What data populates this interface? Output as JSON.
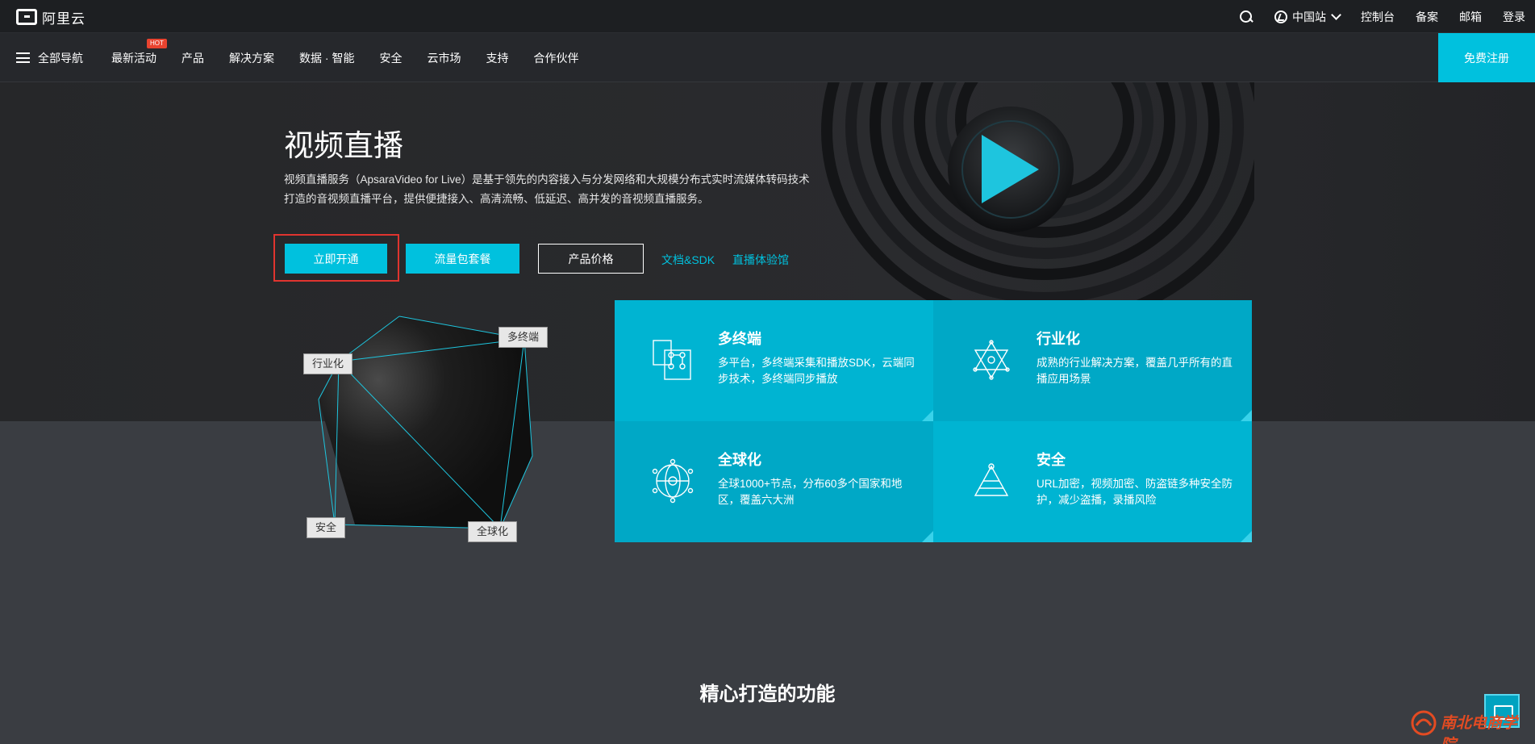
{
  "topbar": {
    "logo_text": "阿里云",
    "region": "中国站",
    "links": [
      "控制台",
      "备案",
      "邮箱",
      "登录"
    ]
  },
  "navbar": {
    "all_nav": "全部导航",
    "items": [
      "最新活动",
      "产品",
      "解决方案",
      "数据 · 智能",
      "安全",
      "云市场",
      "支持",
      "合作伙伴"
    ],
    "hot_badge": "HOT",
    "register": "免费注册"
  },
  "hero": {
    "title": "视频直播",
    "description": "视频直播服务（ApsaraVideo for Live）是基于领先的内容接入与分发网络和大规模分布式实时流媒体转码技术打造的音视频直播平台，提供便捷接入、高清流畅、低延迟、高并发的音视频直播服务。",
    "buttons": {
      "activate": "立即开通",
      "traffic_package": "流量包套餐",
      "pricing": "产品价格"
    },
    "links": {
      "docs": "文档&SDK",
      "experience": "直播体验馆"
    }
  },
  "diagram": {
    "tags": {
      "multi_terminal": "多终端",
      "industry": "行业化",
      "security": "安全",
      "global": "全球化"
    }
  },
  "features": [
    {
      "title": "多终端",
      "desc": "多平台，多终端采集和播放SDK，云端同步技术，多终端同步播放",
      "icon": "multi-terminal-icon"
    },
    {
      "title": "行业化",
      "desc": "成熟的行业解决方案，覆盖几乎所有的直播应用场景",
      "icon": "industry-icon"
    },
    {
      "title": "全球化",
      "desc": "全球1000+节点，分布60多个国家和地区，覆盖六大洲",
      "icon": "globe-network-icon"
    },
    {
      "title": "安全",
      "desc": "URL加密，视频加密、防盗链多种安全防护，减少盗播，录播风险",
      "icon": "pyramid-icon"
    }
  ],
  "section_title": "精心打造的功能",
  "watermark": {
    "text": "南北电商学院"
  },
  "colors": {
    "accent": "#00c1de",
    "highlight_border": "#e0342f",
    "hot": "#e8432f"
  }
}
